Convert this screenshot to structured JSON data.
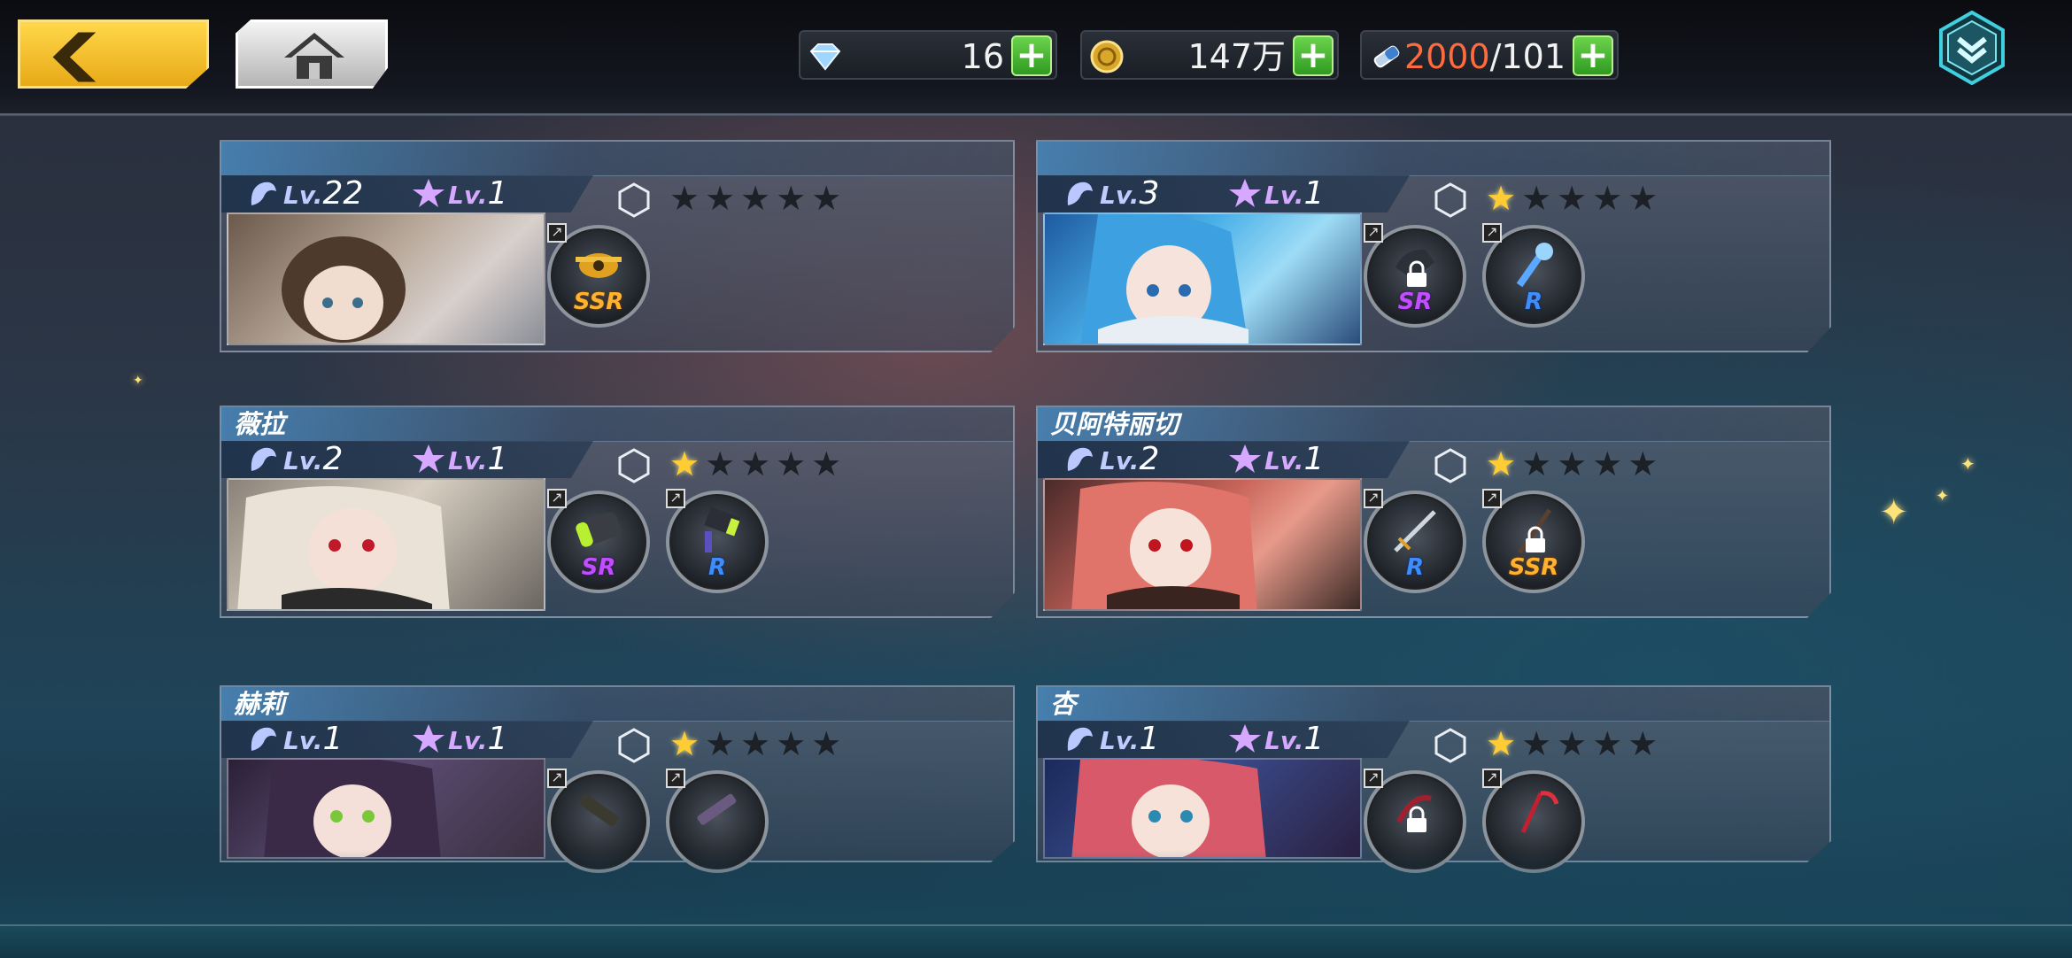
{
  "header": {
    "back_icon": "back-arrow-icon",
    "home_icon": "home-icon",
    "menu_icon": "chevron-down-badge-icon",
    "resources": [
      {
        "name": "diamond",
        "value": "16"
      },
      {
        "name": "gold",
        "value": "147万"
      },
      {
        "name": "stamina",
        "current": "2000",
        "separator": "/",
        "max": "101"
      }
    ],
    "accent_colors": {
      "back": "#f2c230",
      "plus": "#46b82e",
      "stamina_current": "#ff6b3d"
    }
  },
  "characters": [
    {
      "name": "",
      "level": "22",
      "star_level": "1",
      "stars_on": 0,
      "gear": [
        {
          "rarity": "SSR",
          "locked": false
        }
      ]
    },
    {
      "name": "",
      "level": "3",
      "star_level": "1",
      "stars_on": 1,
      "gear": [
        {
          "rarity": "SR",
          "locked": true
        },
        {
          "rarity": "R",
          "locked": false
        }
      ]
    },
    {
      "name": "薇拉",
      "level": "2",
      "star_level": "1",
      "stars_on": 1,
      "gear": [
        {
          "rarity": "SR",
          "locked": false
        },
        {
          "rarity": "R",
          "locked": false
        }
      ]
    },
    {
      "name": "贝阿特丽切",
      "level": "2",
      "star_level": "1",
      "stars_on": 1,
      "gear": [
        {
          "rarity": "R",
          "locked": false
        },
        {
          "rarity": "SSR",
          "locked": true
        }
      ]
    },
    {
      "name": "赫莉",
      "level": "1",
      "star_level": "1",
      "stars_on": 1,
      "gear": [
        {
          "rarity": "",
          "locked": false
        },
        {
          "rarity": "",
          "locked": false
        }
      ]
    },
    {
      "name": "杏",
      "level": "1",
      "star_level": "1",
      "stars_on": 1,
      "gear": [
        {
          "rarity": "",
          "locked": true
        },
        {
          "rarity": "",
          "locked": false
        }
      ]
    }
  ],
  "labels": {
    "lv": "Lv."
  }
}
